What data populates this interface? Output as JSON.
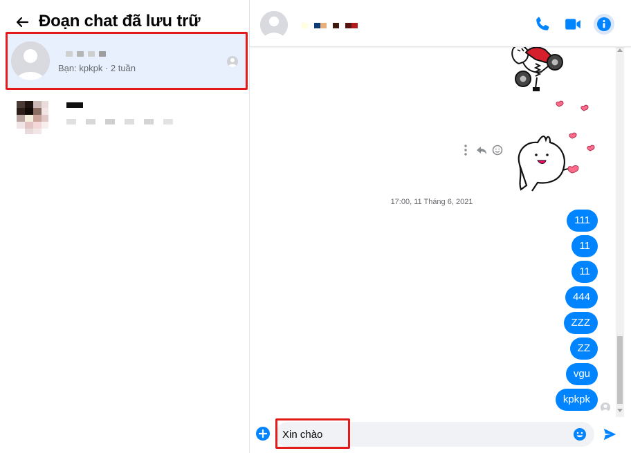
{
  "left": {
    "title": "Đoạn chat đã lưu trữ",
    "conversations": [
      {
        "name_colors": [
          "#d0d0d0",
          "#b5b5b5",
          "#cfcfcf",
          "#9d9d9d"
        ],
        "preview": "Bạn: kpkpk · 2 tuần",
        "selected": true
      },
      {
        "name_color": "#111111",
        "preview_colors": [
          "#e0e0e0",
          "#ffffff",
          "#d8d8d8",
          "#ffffff",
          "#cfcfcf",
          "#ffffff",
          "#dedede",
          "#ffffff",
          "#d4d4d4",
          "#ffffff",
          "#e3e3e3"
        ]
      }
    ]
  },
  "header": {
    "name_colors": [
      "#ffffe0",
      "#ffffff",
      "#0b3a78",
      "#e8b07a",
      "#ffffff",
      "#3e1a0f",
      "#ffffff",
      "#5a1410",
      "#b21c1c"
    ],
    "icons": [
      "phone-icon",
      "video-camera-icon",
      "info-icon"
    ]
  },
  "messages": {
    "timestamp": "17:00, 11 Tháng 6, 2021",
    "bubbles": [
      "111",
      "11",
      "11",
      "444",
      "ZZZ",
      "ZZ",
      "vgu",
      "kpkpk"
    ],
    "action_icons": [
      "more-vertical-icon",
      "reply-icon",
      "react-smiley-icon"
    ]
  },
  "composer": {
    "value": "Xin chào",
    "icons": [
      "add-circle-icon",
      "emoji-icon",
      "send-icon"
    ]
  },
  "colors": {
    "accent": "#0084ff",
    "selected_bg": "#e8f0fd",
    "highlight_box": "#e21b1b",
    "muted_text": "#65676b"
  }
}
